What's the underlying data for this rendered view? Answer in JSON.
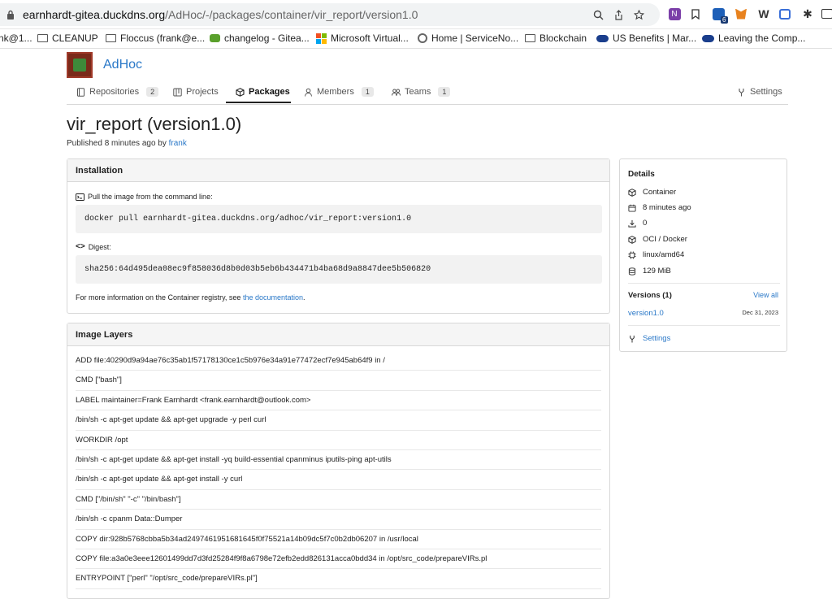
{
  "browser": {
    "url_prefix": "earnhardt-gitea.duckdns.org",
    "url_path": "/AdHoc/-/packages/container/vir_report/version1.0",
    "extension_badge": "6"
  },
  "bookmarks": [
    {
      "label": "nk@1..."
    },
    {
      "label": "CLEANUP"
    },
    {
      "label": "Floccus (frank@e..."
    },
    {
      "label": "changelog - Gitea..."
    },
    {
      "label": "Microsoft Virtual..."
    },
    {
      "label": "Home | ServiceNo..."
    },
    {
      "label": "Blockchain"
    },
    {
      "label": "US Benefits | Mar..."
    },
    {
      "label": "Leaving the Comp..."
    }
  ],
  "org": {
    "name": "AdHoc"
  },
  "tabs": [
    {
      "label": "Repositories",
      "count": "2"
    },
    {
      "label": "Projects"
    },
    {
      "label": "Packages"
    },
    {
      "label": "Members",
      "count": "1"
    },
    {
      "label": "Teams",
      "count": "1"
    },
    {
      "label": "Settings"
    }
  ],
  "package": {
    "title": "vir_report (version1.0)",
    "published_text": "Published 8 minutes ago by",
    "publisher": "frank"
  },
  "installation": {
    "heading": "Installation",
    "pull_label": "Pull the image from the command line:",
    "pull_command": "docker pull earnhardt-gitea.duckdns.org/adhoc/vir_report:version1.0",
    "digest_label": "Digest:",
    "digest": "sha256:64d495dea08ec9f858036d8b0d03b5eb6b434471b4ba68d9a8847dee5b506820",
    "note_text": "For more information on the Container registry, see",
    "note_link": "the documentation",
    "note_end": "."
  },
  "layers": {
    "heading": "Image Layers",
    "items": [
      "ADD file:40290d9a94ae76c35ab1f57178130ce1c5b976e34a91e77472ecf7e945ab64f9 in /",
      "CMD [\"bash\"]",
      "LABEL maintainer=Frank Earnhardt <frank.earnhardt@outlook.com>",
      "/bin/sh -c apt-get update && apt-get upgrade -y perl curl",
      "WORKDIR /opt",
      "/bin/sh -c apt-get update && apt-get install -yq build-essential cpanminus iputils-ping apt-utils",
      "/bin/sh -c apt-get update && apt-get install -y curl",
      "CMD [\"/bin/sh\" \"-c\" \"/bin/bash\"]",
      "/bin/sh -c cpanm Data::Dumper",
      "COPY dir:928b5768cbba5b34ad2497461951681645f0f75521a14b09dc5f7c0b2db06207 in /usr/local",
      "COPY file:a3a0e3eee12601499dd7d3fd25284f9f8a6798e72efb2edd826131acca0bdd34 in /opt/src_code/prepareVIRs.pl",
      "ENTRYPOINT [\"perl\" \"/opt/src_code/prepareVIRs.pl\"]"
    ]
  },
  "details": {
    "heading": "Details",
    "rows": [
      {
        "icon": "package-icon",
        "text": "Container"
      },
      {
        "icon": "calendar-icon",
        "text": "8 minutes ago"
      },
      {
        "icon": "download-icon",
        "text": "0"
      },
      {
        "icon": "package-icon",
        "text": "OCI / Docker"
      },
      {
        "icon": "cpu-icon",
        "text": "linux/amd64"
      },
      {
        "icon": "database-icon",
        "text": "129 MiB"
      }
    ],
    "versions_heading": "Versions (1)",
    "view_all": "View all",
    "version": "version1.0",
    "version_date": "Dec 31, 2023",
    "settings": "Settings"
  }
}
